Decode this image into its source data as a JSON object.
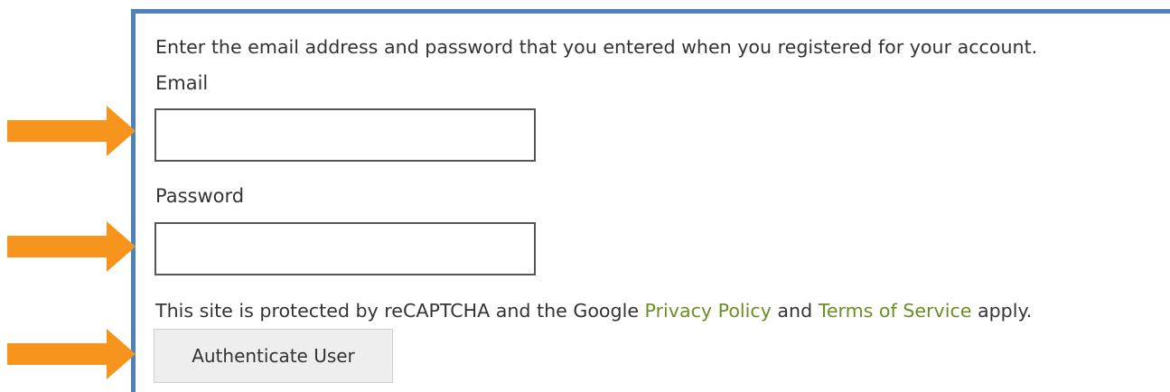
{
  "form": {
    "intro_text": "Enter the email address and password that you entered when you registered for your account.",
    "email_label": "Email",
    "email_value": "",
    "password_label": "Password",
    "password_value": "",
    "recaptcha_prefix": "This site is protected by reCAPTCHA and the Google ",
    "privacy_link": "Privacy Policy",
    "recaptcha_middle": " and ",
    "terms_link": "Terms of Service",
    "recaptcha_suffix": " apply.",
    "submit_label": "Authenticate User"
  },
  "annotations": {
    "arrow_color": "#f7941d",
    "frame_color": "#4f81bd",
    "arrow_icon": "arrow-right-icon"
  }
}
